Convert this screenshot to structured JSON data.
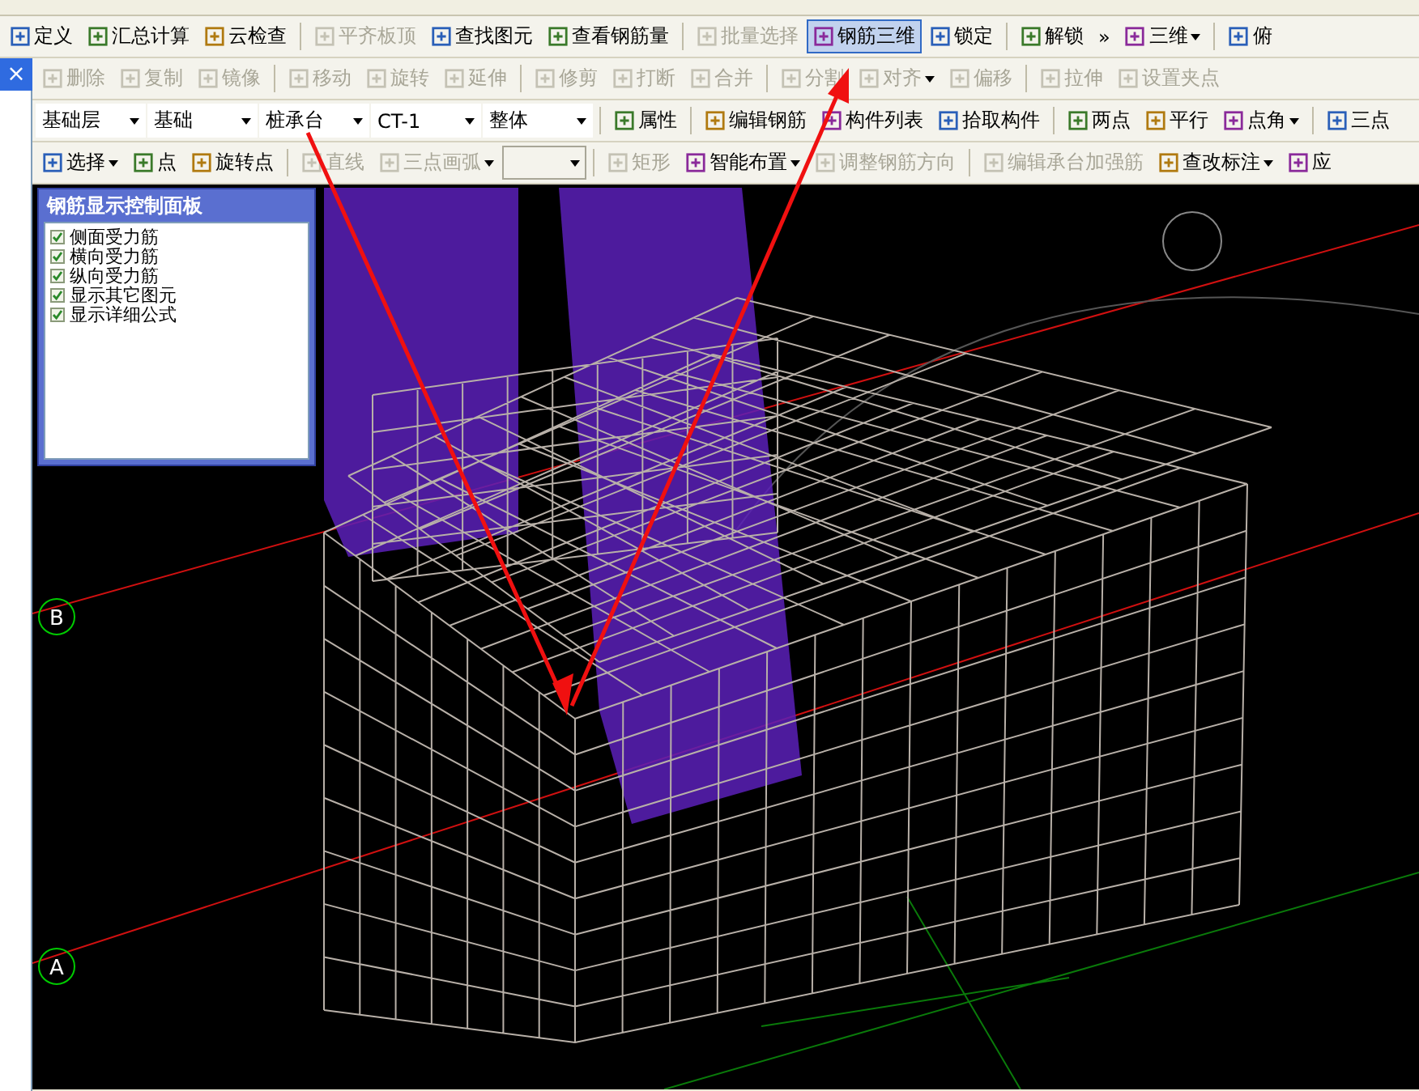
{
  "toolbars": [
    {
      "items": [
        {
          "label": "定义",
          "kind": "button",
          "disabled": false,
          "selected": false
        },
        {
          "label": "汇总计算",
          "kind": "button",
          "disabled": false,
          "selected": false
        },
        {
          "label": "云检查",
          "kind": "button",
          "disabled": false,
          "selected": false
        },
        {
          "label": "平齐板顶",
          "kind": "button",
          "disabled": true,
          "selected": false
        },
        {
          "label": "查找图元",
          "kind": "button",
          "disabled": false,
          "selected": false
        },
        {
          "label": "查看钢筋量",
          "kind": "button",
          "disabled": false,
          "selected": false
        },
        {
          "label": "批量选择",
          "kind": "button",
          "disabled": true,
          "selected": false
        },
        {
          "label": "钢筋三维",
          "kind": "button",
          "disabled": false,
          "selected": true
        },
        {
          "label": "锁定",
          "kind": "button",
          "disabled": false,
          "selected": false
        },
        {
          "label": "解锁",
          "kind": "button",
          "disabled": false,
          "selected": false
        },
        {
          "label": "»",
          "kind": "overflow",
          "disabled": false,
          "selected": false
        },
        {
          "label": "三维",
          "kind": "menu",
          "disabled": false,
          "selected": false
        },
        {
          "label": "俯",
          "kind": "button",
          "disabled": false,
          "selected": false
        }
      ]
    },
    {
      "items": [
        {
          "label": "删除",
          "kind": "button",
          "disabled": true,
          "selected": false
        },
        {
          "label": "复制",
          "kind": "button",
          "disabled": true,
          "selected": false
        },
        {
          "label": "镜像",
          "kind": "button",
          "disabled": true,
          "selected": false
        },
        {
          "label": "移动",
          "kind": "button",
          "disabled": true,
          "selected": false
        },
        {
          "label": "旋转",
          "kind": "button",
          "disabled": true,
          "selected": false
        },
        {
          "label": "延伸",
          "kind": "button",
          "disabled": true,
          "selected": false
        },
        {
          "label": "修剪",
          "kind": "button",
          "disabled": true,
          "selected": false
        },
        {
          "label": "打断",
          "kind": "button",
          "disabled": true,
          "selected": false
        },
        {
          "label": "合并",
          "kind": "button",
          "disabled": true,
          "selected": false
        },
        {
          "label": "分割",
          "kind": "button",
          "disabled": true,
          "selected": false
        },
        {
          "label": "对齐",
          "kind": "menu",
          "disabled": true,
          "selected": false
        },
        {
          "label": "偏移",
          "kind": "button",
          "disabled": true,
          "selected": false
        },
        {
          "label": "拉伸",
          "kind": "button",
          "disabled": true,
          "selected": false
        },
        {
          "label": "设置夹点",
          "kind": "button",
          "disabled": true,
          "selected": false
        }
      ]
    },
    {
      "items": [
        {
          "label": "基础层",
          "kind": "combo",
          "disabled": false,
          "selected": false
        },
        {
          "label": "基础",
          "kind": "combo",
          "disabled": false,
          "selected": false
        },
        {
          "label": "桩承台",
          "kind": "combo",
          "disabled": false,
          "selected": false
        },
        {
          "label": "CT-1",
          "kind": "combo",
          "disabled": false,
          "selected": false
        },
        {
          "label": "整体",
          "kind": "combo",
          "disabled": false,
          "selected": false
        },
        {
          "label": "属性",
          "kind": "button",
          "disabled": false,
          "selected": false
        },
        {
          "label": "编辑钢筋",
          "kind": "button",
          "disabled": false,
          "selected": false
        },
        {
          "label": "构件列表",
          "kind": "button",
          "disabled": false,
          "selected": false
        },
        {
          "label": "拾取构件",
          "kind": "button",
          "disabled": false,
          "selected": false
        },
        {
          "label": "两点",
          "kind": "button",
          "disabled": false,
          "selected": false
        },
        {
          "label": "平行",
          "kind": "button",
          "disabled": false,
          "selected": false
        },
        {
          "label": "点角",
          "kind": "menu",
          "disabled": false,
          "selected": false
        },
        {
          "label": "三点",
          "kind": "button",
          "disabled": false,
          "selected": false
        }
      ]
    },
    {
      "items": [
        {
          "label": "选择",
          "kind": "menu",
          "disabled": false,
          "selected": false
        },
        {
          "label": "点",
          "kind": "button",
          "disabled": false,
          "selected": false
        },
        {
          "label": "旋转点",
          "kind": "button",
          "disabled": false,
          "selected": false
        },
        {
          "label": "直线",
          "kind": "button",
          "disabled": true,
          "selected": false
        },
        {
          "label": "三点画弧",
          "kind": "menu",
          "disabled": true,
          "selected": false
        },
        {
          "kind": "combo",
          "disabled": true,
          "selected": false
        },
        {
          "label": "矩形",
          "kind": "button",
          "disabled": true,
          "selected": false
        },
        {
          "label": "智能布置",
          "kind": "menu",
          "disabled": false,
          "selected": false
        },
        {
          "label": "调整钢筋方向",
          "kind": "button",
          "disabled": true,
          "selected": false
        },
        {
          "label": "编辑承台加强筋",
          "kind": "button",
          "disabled": true,
          "selected": false
        },
        {
          "label": "查改标注",
          "kind": "menu",
          "disabled": false,
          "selected": false
        },
        {
          "label": "应",
          "kind": "button",
          "disabled": false,
          "selected": false
        }
      ]
    }
  ],
  "side_tab": {
    "close": "×"
  },
  "rebar_panel": {
    "title": "钢筋显示控制面板",
    "items": [
      {
        "label": "侧面受力筋",
        "checked": true
      },
      {
        "label": "横向受力筋",
        "checked": true
      },
      {
        "label": "纵向受力筋",
        "checked": true
      },
      {
        "label": "显示其它图元",
        "checked": true
      },
      {
        "label": "显示详细公式",
        "checked": true
      }
    ]
  },
  "view": {
    "axes": [
      {
        "label": "B"
      },
      {
        "label": "A"
      }
    ]
  }
}
